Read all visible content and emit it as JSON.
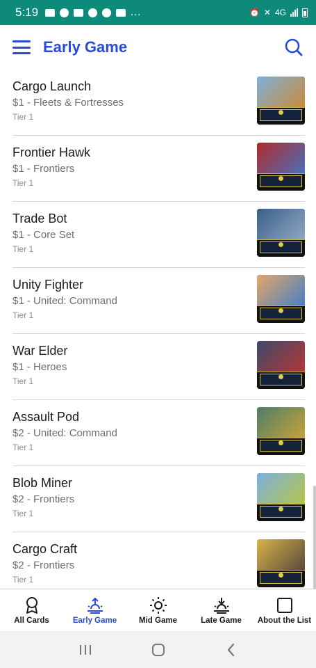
{
  "status_bar": {
    "time": "5:19",
    "dots": "…",
    "network": "4G"
  },
  "app_bar": {
    "title": "Early Game"
  },
  "colors": {
    "accent": "#2a4bd7",
    "status_bar": "#0e8a7a"
  },
  "cards": [
    {
      "name": "Cargo Launch",
      "subtitle": "$1 - Fleets & Fortresses",
      "tier": "Tier 1",
      "art_colors": [
        "#7fb0d9",
        "#c98b3a"
      ]
    },
    {
      "name": "Frontier Hawk",
      "subtitle": "$1 - Frontiers",
      "tier": "Tier 1",
      "art_colors": [
        "#b22a2a",
        "#4a6fb8"
      ]
    },
    {
      "name": "Trade Bot",
      "subtitle": "$1 - Core Set",
      "tier": "Tier 1",
      "art_colors": [
        "#3b5f8a",
        "#8fa7c4"
      ]
    },
    {
      "name": "Unity Fighter",
      "subtitle": "$1 - United: Command",
      "tier": "Tier 1",
      "art_colors": [
        "#e3a766",
        "#4a7fc4"
      ]
    },
    {
      "name": "War Elder",
      "subtitle": "$1 - Heroes",
      "tier": "Tier 1",
      "art_colors": [
        "#3d4a6a",
        "#b23838"
      ]
    },
    {
      "name": "Assault Pod",
      "subtitle": "$2 - United: Command",
      "tier": "Tier 1",
      "art_colors": [
        "#4f7d6a",
        "#c4a23a"
      ]
    },
    {
      "name": "Blob Miner",
      "subtitle": "$2 - Frontiers",
      "tier": "Tier 1",
      "art_colors": [
        "#7ab0e0",
        "#b8c44a"
      ]
    },
    {
      "name": "Cargo Craft",
      "subtitle": "$2 - Frontiers",
      "tier": "Tier 1",
      "art_colors": [
        "#d9b34a",
        "#5a4a3a"
      ]
    }
  ],
  "bottom_nav": [
    {
      "label": "All Cards",
      "icon": "award-icon",
      "active": false
    },
    {
      "label": "Early Game",
      "icon": "sunrise-icon",
      "active": true
    },
    {
      "label": "Mid Game",
      "icon": "sun-icon",
      "active": false
    },
    {
      "label": "Late Game",
      "icon": "sunset-icon",
      "active": false
    },
    {
      "label": "About the List",
      "icon": "square-icon",
      "active": false
    }
  ]
}
